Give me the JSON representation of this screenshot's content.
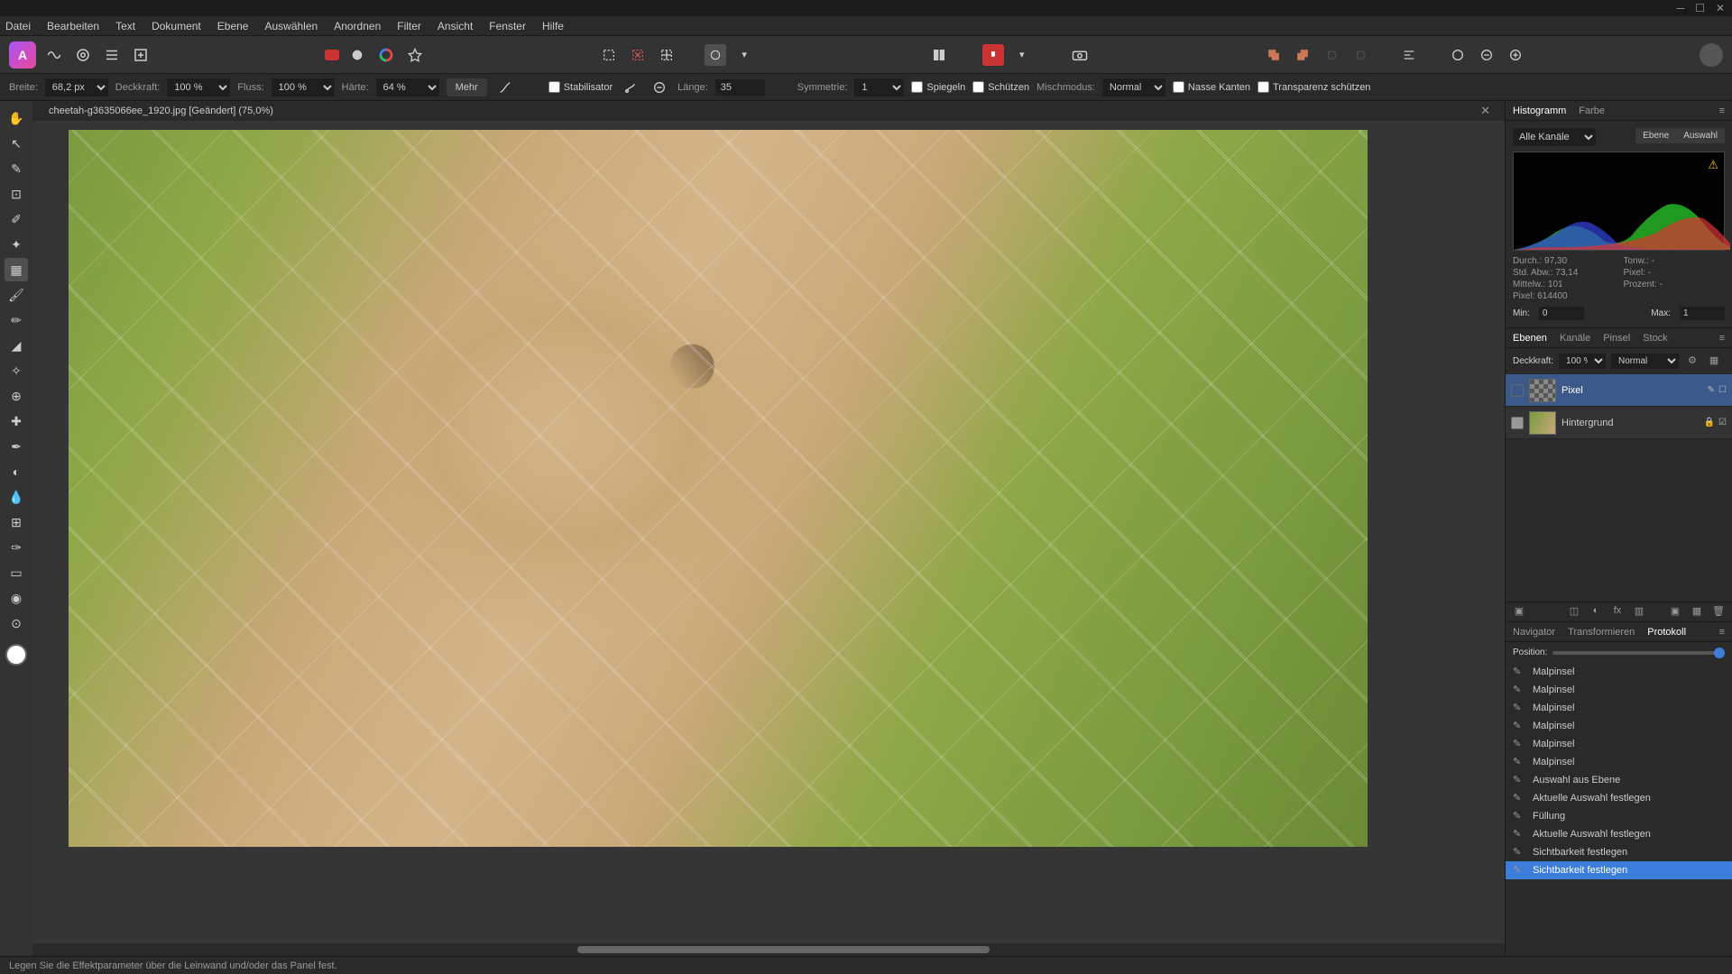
{
  "menu": [
    "Datei",
    "Bearbeiten",
    "Text",
    "Dokument",
    "Ebene",
    "Auswählen",
    "Anordnen",
    "Filter",
    "Ansicht",
    "Fenster",
    "Hilfe"
  ],
  "context": {
    "breite_label": "Breite:",
    "breite": "68,2 px",
    "deckkraft_label": "Deckkraft:",
    "deckkraft": "100 %",
    "fluss_label": "Fluss:",
    "fluss": "100 %",
    "haerte_label": "Härte:",
    "haerte": "64 %",
    "mehr": "Mehr",
    "stabilisator": "Stabilisator",
    "laenge_label": "Länge:",
    "laenge": "35",
    "symmetrie_label": "Symmetrie:",
    "symmetrie": "1",
    "spiegeln": "Spiegeln",
    "schuetzen": "Schützen",
    "mischmodus_label": "Mischmodus:",
    "mischmodus": "Normal",
    "nasse_kanten": "Nasse Kanten",
    "transparenz": "Transparenz schützen"
  },
  "document": {
    "title": "cheetah-g3635066ee_1920.jpg [Geändert] (75,0%)"
  },
  "panels": {
    "histogram": {
      "tabs": [
        "Histogramm",
        "Farbe"
      ],
      "channels": "Alle Kanäle",
      "btn_ebene": "Ebene",
      "btn_auswahl": "Auswahl",
      "stats": {
        "durch": "Durch.: 97,30",
        "std": "Std. Abw.: 73,14",
        "mittel": "Mittelw.: 101",
        "pixel": "Pixel: 614400",
        "tonw": "Tonw.: -",
        "pixel2": "Pixel: -",
        "prozent": "Prozent: -"
      },
      "min_label": "Min:",
      "min": "0",
      "max_label": "Max:",
      "max": "1"
    },
    "layers": {
      "tabs": [
        "Ebenen",
        "Kanäle",
        "Pinsel",
        "Stock"
      ],
      "deckkraft_label": "Deckkraft:",
      "deckkraft": "100 %",
      "blend": "Normal",
      "items": [
        {
          "name": "Pixel",
          "selected": true
        },
        {
          "name": "Hintergrund",
          "selected": false
        }
      ]
    },
    "history": {
      "tabs": [
        "Navigator",
        "Transformieren",
        "Protokoll"
      ],
      "position_label": "Position:",
      "items": [
        "Malpinsel",
        "Malpinsel",
        "Malpinsel",
        "Malpinsel",
        "Malpinsel",
        "Malpinsel",
        "Auswahl aus Ebene",
        "Aktuelle Auswahl festlegen",
        "Füllung",
        "Aktuelle Auswahl festlegen",
        "Sichtbarkeit festlegen",
        "Sichtbarkeit festlegen"
      ],
      "selected_index": 11
    }
  },
  "status": "Legen Sie die Effektparameter über die Leinwand und/oder das Panel fest."
}
